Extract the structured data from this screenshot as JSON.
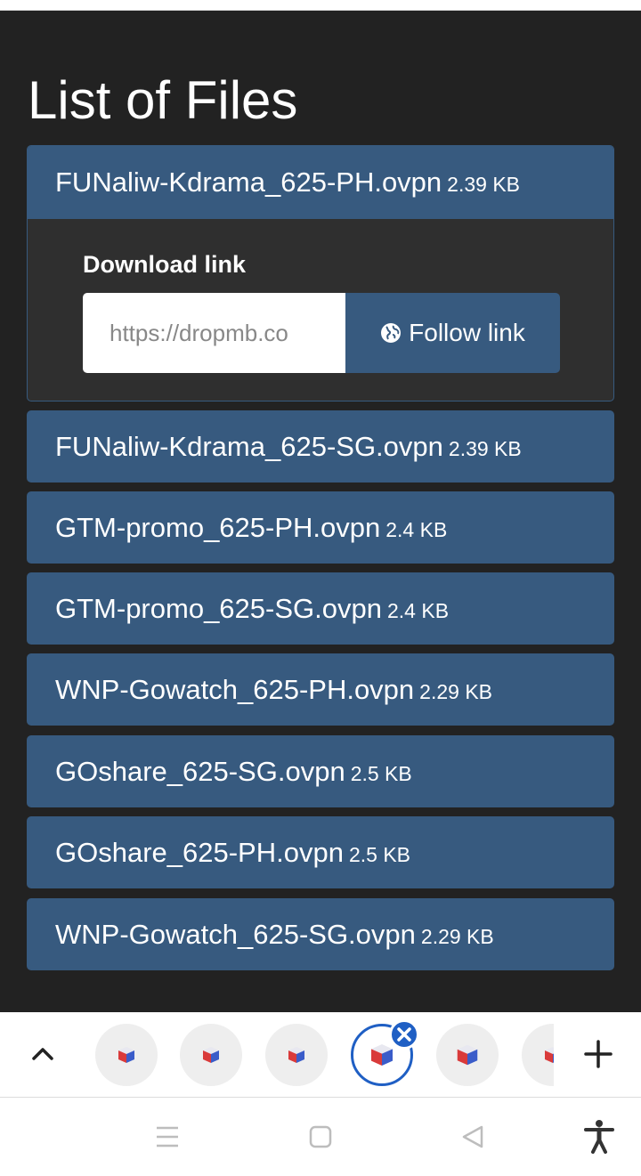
{
  "page": {
    "title": "List of Files"
  },
  "files": [
    {
      "name": "FUNaliw-Kdrama_625-PH.ovpn",
      "size": "2.39 KB"
    },
    {
      "name": "FUNaliw-Kdrama_625-SG.ovpn",
      "size": "2.39 KB"
    },
    {
      "name": "GTM-promo_625-PH.ovpn",
      "size": "2.4 KB"
    },
    {
      "name": "GTM-promo_625-SG.ovpn",
      "size": "2.4 KB"
    },
    {
      "name": "WNP-Gowatch_625-PH.ovpn",
      "size": "2.29 KB"
    },
    {
      "name": "GOshare_625-SG.ovpn",
      "size": "2.5 KB"
    },
    {
      "name": "GOshare_625-PH.ovpn",
      "size": "2.5 KB"
    },
    {
      "name": "WNP-Gowatch_625-SG.ovpn",
      "size": "2.29 KB"
    }
  ],
  "download": {
    "label": "Download link",
    "value": "https://dropmb.co",
    "button_label": "Follow link"
  },
  "icons": {
    "globe": "globe-icon",
    "chevron": "chevron-up-icon",
    "tab": "app-cube-icon",
    "close": "close-icon",
    "plus": "plus-icon",
    "menu": "menu-icon",
    "home": "home-square-icon",
    "back": "back-triangle-icon",
    "accessibility": "accessibility-icon"
  },
  "colors": {
    "background": "#222222",
    "accent": "#375a7f",
    "tab_active": "#1f5fc4"
  }
}
